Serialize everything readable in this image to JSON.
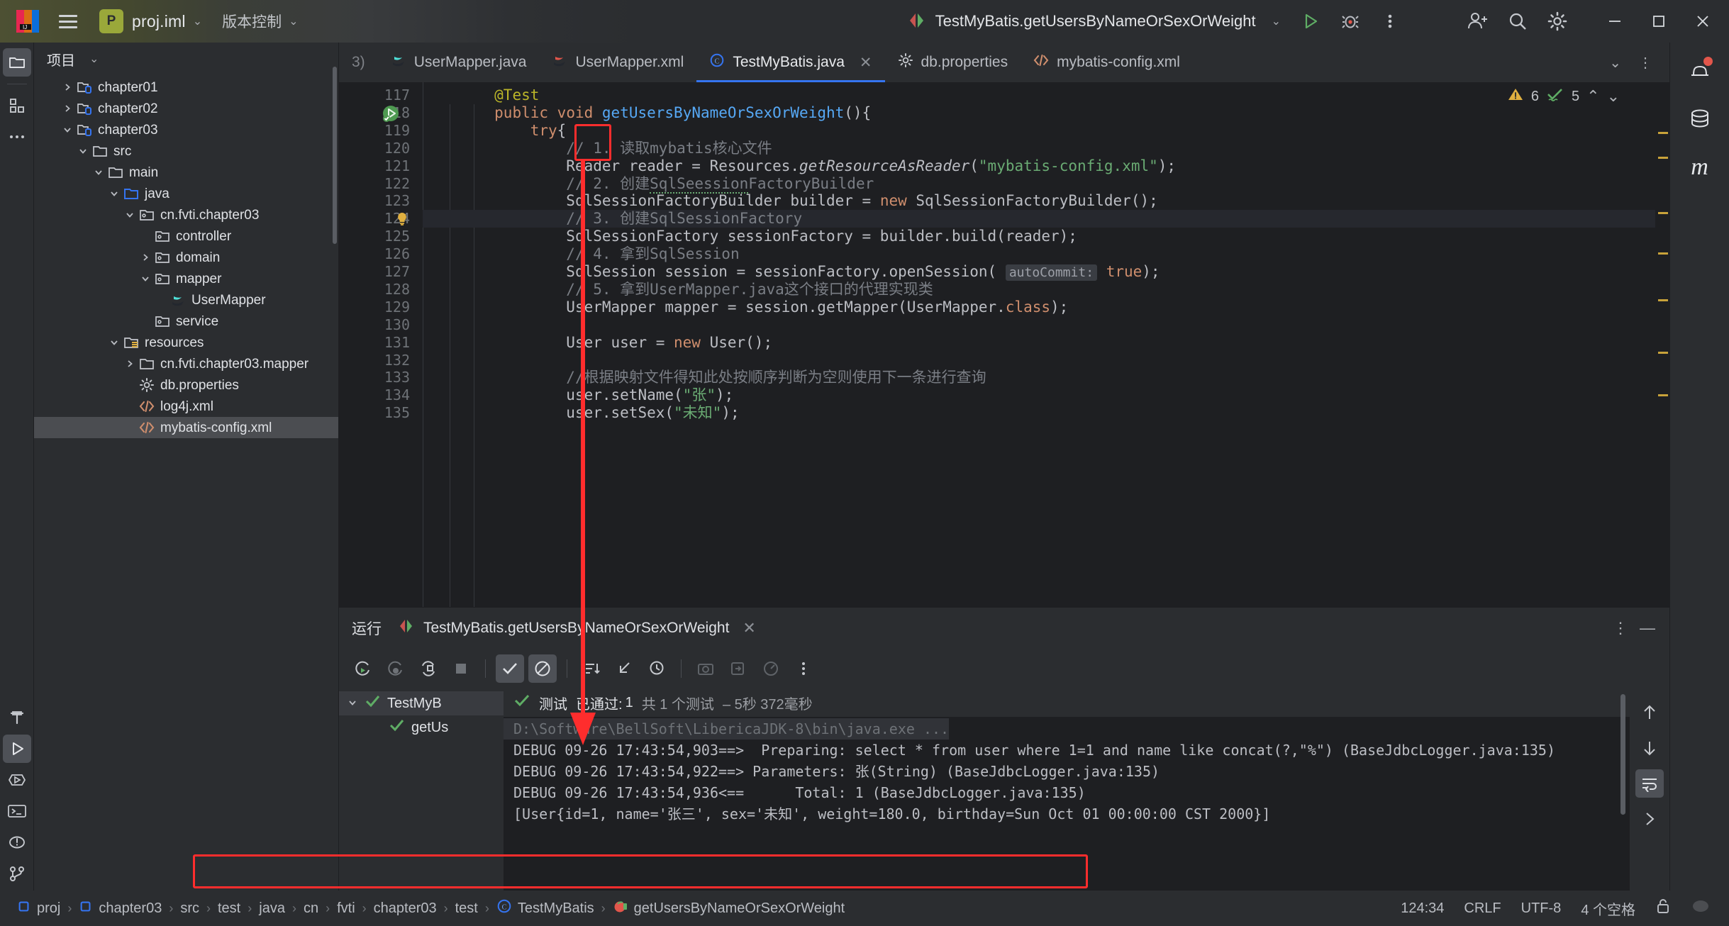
{
  "toolbar": {
    "project_badge": "P",
    "project_name": "proj.iml",
    "vcs_label": "版本控制",
    "run_config": "TestMyBatis.getUsersByNameOrSexOrWeight"
  },
  "project_panel": {
    "title": "项目",
    "tree": [
      {
        "label": "chapter01",
        "indent": 1,
        "arrow": "right",
        "icon": "module-folder-icon"
      },
      {
        "label": "chapter02",
        "indent": 1,
        "arrow": "right",
        "icon": "module-folder-icon"
      },
      {
        "label": "chapter03",
        "indent": 1,
        "arrow": "down",
        "icon": "module-folder-icon"
      },
      {
        "label": "src",
        "indent": 2,
        "arrow": "down",
        "icon": "folder-icon"
      },
      {
        "label": "main",
        "indent": 3,
        "arrow": "down",
        "icon": "folder-icon"
      },
      {
        "label": "java",
        "indent": 4,
        "arrow": "down",
        "icon": "source-folder-icon"
      },
      {
        "label": "cn.fvti.chapter03",
        "indent": 5,
        "arrow": "down",
        "icon": "package-icon"
      },
      {
        "label": "controller",
        "indent": 6,
        "arrow": "none",
        "icon": "package-icon"
      },
      {
        "label": "domain",
        "indent": 6,
        "arrow": "right",
        "icon": "package-icon"
      },
      {
        "label": "mapper",
        "indent": 6,
        "arrow": "down",
        "icon": "package-icon"
      },
      {
        "label": "UserMapper",
        "indent": 7,
        "arrow": "none",
        "icon": "java-interface-icon"
      },
      {
        "label": "service",
        "indent": 6,
        "arrow": "none",
        "icon": "package-icon"
      },
      {
        "label": "resources",
        "indent": 4,
        "arrow": "down",
        "icon": "resources-folder-icon"
      },
      {
        "label": "cn.fvti.chapter03.mapper",
        "indent": 5,
        "arrow": "right",
        "icon": "folder-icon"
      },
      {
        "label": "db.properties",
        "indent": 5,
        "arrow": "none",
        "icon": "gear-icon"
      },
      {
        "label": "log4j.xml",
        "indent": 5,
        "arrow": "none",
        "icon": "xml-icon"
      },
      {
        "label": "mybatis-config.xml",
        "indent": 5,
        "arrow": "none",
        "icon": "xml-icon",
        "selected": true
      }
    ]
  },
  "tabs": {
    "items": [
      {
        "label": "UserMapper.java",
        "icon": "java-interface-icon",
        "active": false
      },
      {
        "label": "UserMapper.xml",
        "icon": "mybatis-mapper-icon",
        "active": false
      },
      {
        "label": "TestMyBatis.java",
        "icon": "java-class-icon",
        "active": true,
        "closable": true
      },
      {
        "label": "db.properties",
        "icon": "gear-icon",
        "active": false
      },
      {
        "label": "mybatis-config.xml",
        "icon": "xml-icon",
        "active": false
      }
    ],
    "truncated_left": "3)"
  },
  "inspections": {
    "warning_count": "6",
    "weak_warning_count": "5"
  },
  "editor": {
    "first_line_number": 117,
    "lines": [
      {
        "n": 117,
        "html": "        <span class='an'>@Test</span>"
      },
      {
        "n": 118,
        "html": "        <span class='k'>public</span> <span class='k'>void</span> <span class='fn'>getUsersByNameOrSexOrWeight</span><span class='df'>(){</span>"
      },
      {
        "n": 119,
        "html": "            <span class='k'>try</span><span class='df'>{</span>"
      },
      {
        "n": 120,
        "html": "                <span class='cm'>// 1. 读取mybatis核心文件</span>"
      },
      {
        "n": 121,
        "html": "                <span class='df'>Reader reader = Resources.</span><span class='mi'>getResourceAsReader</span><span class='df'>(</span><span class='st'>\"mybatis-config.xml\"</span><span class='df'>);</span>"
      },
      {
        "n": 122,
        "html": "                <span class='cm'>// 2. 创建</span><span class='cm squig'>SqlSeession</span><span class='cm'>FactoryBuilder</span>"
      },
      {
        "n": 123,
        "html": "                <span class='df'>SqlSessionFactoryBuilder builder = </span><span class='k'>new</span><span class='df'> SqlSessionFactoryBuilder();</span>"
      },
      {
        "n": 124,
        "html": "                <span class='cm'>// 3. 创建SqlSessionFactory</span>",
        "highlight": true,
        "bulb": true
      },
      {
        "n": 125,
        "html": "                <span class='df'>SqlSessionFactory sessionFactory = builder.build(reader);</span>"
      },
      {
        "n": 126,
        "html": "                <span class='cm'>// 4. 拿到SqlSession</span>"
      },
      {
        "n": 127,
        "html": "                <span class='df'>SqlSession session = sessionFactory.openSession(</span> <span class='hint'>autoCommit:</span> <span class='k'>true</span><span class='df'>);</span>"
      },
      {
        "n": 128,
        "html": "                <span class='cm'>// 5. 拿到UserMapper.java这个接口的代理实现类</span>"
      },
      {
        "n": 129,
        "html": "                <span class='df'>UserMapper mapper = session.getMapper(UserMapper.</span><span class='k'>class</span><span class='df'>);</span>"
      },
      {
        "n": 130,
        "html": ""
      },
      {
        "n": 131,
        "html": "                <span class='df'>User user = </span><span class='k'>new</span><span class='df'> User();</span>"
      },
      {
        "n": 132,
        "html": ""
      },
      {
        "n": 133,
        "html": "                <span class='cm'>//根据映射文件得知此处按顺序判断为空则使用下一条进行查询</span>"
      },
      {
        "n": 134,
        "html": "                <span class='df'>user.setName(</span><span class='st'>\"张\"</span><span class='df'>);</span>"
      },
      {
        "n": 135,
        "html": "                <span class='df'>user.setSex(</span><span class='st'>\"未知\"</span><span class='df'>);</span>"
      }
    ]
  },
  "run_panel": {
    "title": "运行",
    "tab_label": "TestMyBatis.getUsersByNameOrSexOrWeight",
    "test_tree": [
      {
        "label": "TestMyB",
        "status": "pass",
        "indent": 0,
        "expanded": true,
        "selected": true
      },
      {
        "label": "getUs",
        "status": "pass",
        "indent": 1
      }
    ],
    "status_line": {
      "prefix": "测试",
      "passed_label": "已通过:",
      "passed_count": "1",
      "total": "共 1 个测试",
      "duration": "– 5秒 372毫秒"
    },
    "console": [
      {
        "text": "D:\\Software\\BellSoft\\LibericaJDK-8\\bin\\java.exe ...",
        "style": "dim"
      },
      {
        "text": "DEBUG 09-26 17:43:54,903==>  Preparing: select * from user where 1=1 and name like concat(?,\"%\") (BaseJdbcLogger.java:135)",
        "style": "normal"
      },
      {
        "text": "DEBUG 09-26 17:43:54,922==> Parameters: 张(String) (BaseJdbcLogger.java:135)",
        "style": "normal"
      },
      {
        "text": "DEBUG 09-26 17:43:54,936<==      Total: 1 (BaseJdbcLogger.java:135)",
        "style": "normal"
      },
      {
        "text": "[User{id=1, name='张三', sex='未知', weight=180.0, birthday=Sun Oct 01 00:00:00 CST 2000}]",
        "style": "result",
        "boxed": true
      }
    ]
  },
  "status_bar": {
    "breadcrumbs": [
      {
        "label": "proj",
        "icon": "module-icon"
      },
      {
        "label": "chapter03",
        "icon": "module-icon"
      },
      {
        "label": "src",
        "icon": "none"
      },
      {
        "label": "test",
        "icon": "none"
      },
      {
        "label": "java",
        "icon": "none"
      },
      {
        "label": "cn",
        "icon": "none"
      },
      {
        "label": "fvti",
        "icon": "none"
      },
      {
        "label": "chapter03",
        "icon": "none"
      },
      {
        "label": "test",
        "icon": "none"
      },
      {
        "label": "TestMyBatis",
        "icon": "java-class-icon"
      },
      {
        "label": "getUsersByNameOrSexOrWeight",
        "icon": "test-method-icon"
      }
    ],
    "caret": "124:34",
    "line_sep": "CRLF",
    "encoding": "UTF-8",
    "indent": "4 个空格"
  },
  "colors": {
    "accent_blue": "#3574f0",
    "pass_green": "#5fad65",
    "warn_yellow": "#e0b040",
    "annotation_red": "#ff2d2d",
    "module_green": "#9aa83a"
  }
}
